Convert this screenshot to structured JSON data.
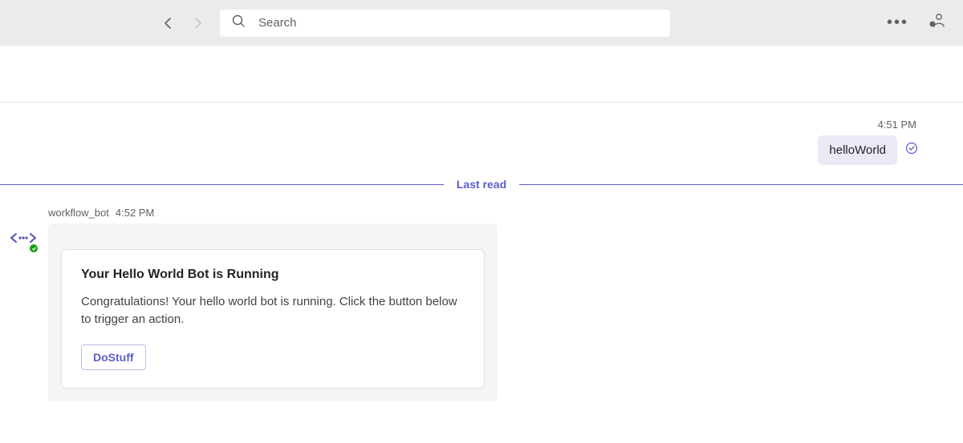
{
  "header": {
    "search_placeholder": "Search"
  },
  "sent": {
    "time": "4:51 PM",
    "text": "helloWorld"
  },
  "divider": {
    "label": "Last read"
  },
  "bot": {
    "name": "workflow_bot",
    "time": "4:52 PM",
    "card": {
      "title": "Your Hello World Bot is Running",
      "body": "Congratulations! Your hello world bot is running. Click the button below to trigger an action.",
      "action_label": "DoStuff"
    }
  }
}
